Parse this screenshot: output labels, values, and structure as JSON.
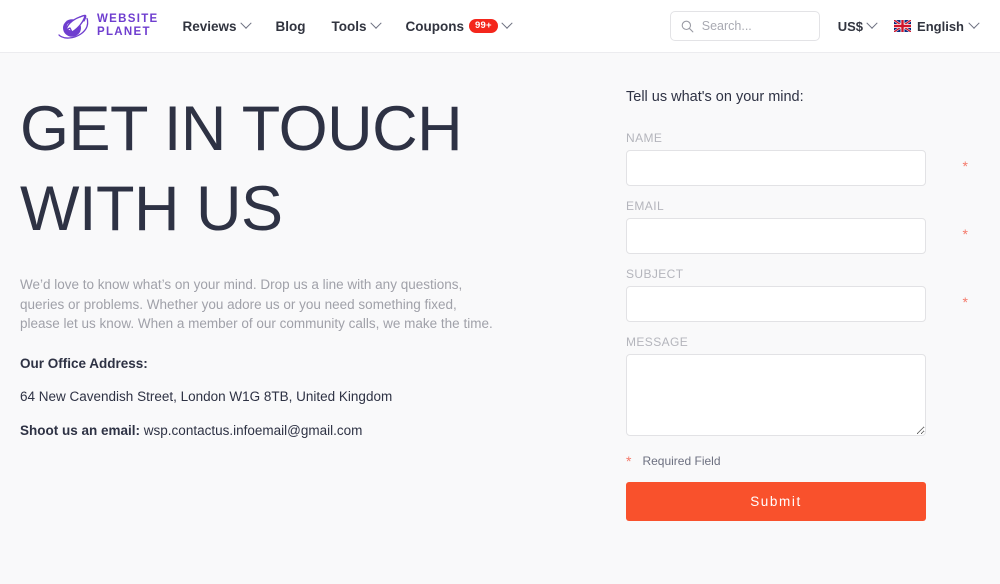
{
  "header": {
    "logo": {
      "icon": "planet-rocket-logo-icon",
      "line1": "WEBSITE",
      "line2": "PLANET",
      "color": "#6f3ecf"
    },
    "nav": [
      {
        "label": "Reviews",
        "has_chevron": true,
        "badge": null
      },
      {
        "label": "Blog",
        "has_chevron": false,
        "badge": null
      },
      {
        "label": "Tools",
        "has_chevron": true,
        "badge": null
      },
      {
        "label": "Coupons",
        "has_chevron": true,
        "badge": "99+"
      }
    ],
    "search": {
      "icon": "search-icon",
      "placeholder": "Search...",
      "value": ""
    },
    "currency": {
      "label": "US$",
      "has_chevron": true
    },
    "language": {
      "flag": "uk-flag-icon",
      "label": "English",
      "has_chevron": true
    },
    "badge_color": "#f4261c"
  },
  "main": {
    "title": "GET IN TOUCH WITH US",
    "intro": "We’d love to know what’s on your mind. Drop us a line with any questions, queries or problems. Whether you adore us or you need something fixed, please let us know. When a member of our community calls, we make the time.",
    "address_heading": "Our Office Address:",
    "address": "64 New Cavendish Street, London W1G 8TB, United Kingdom",
    "email_label": "Shoot us an email:",
    "email": "wsp.contactus.infoemail@gmail.com"
  },
  "form": {
    "title": "Tell us what's on your mind:",
    "fields": [
      {
        "label": "NAME",
        "value": "",
        "placeholder": "",
        "required": true,
        "type": "text"
      },
      {
        "label": "EMAIL",
        "value": "",
        "placeholder": "",
        "required": true,
        "type": "text"
      },
      {
        "label": "SUBJECT",
        "value": "",
        "placeholder": "",
        "required": true,
        "type": "text"
      },
      {
        "label": "MESSAGE",
        "value": "",
        "placeholder": "",
        "required": false,
        "type": "textarea"
      }
    ],
    "required_star": "*",
    "required_note": "Required Field",
    "submit_label": "Submit",
    "submit_color": "#f9512c",
    "star_color": "#f4796a"
  }
}
